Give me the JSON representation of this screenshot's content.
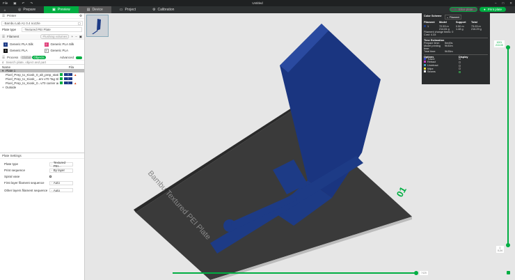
{
  "window": {
    "title": "Untitled",
    "menu": "File"
  },
  "tabs": [
    {
      "label": "Prepare"
    },
    {
      "label": "Preview",
      "active": true
    },
    {
      "label": "Device"
    },
    {
      "label": "Project"
    },
    {
      "label": "Calibration"
    }
  ],
  "actions": {
    "slice": "Slice plate",
    "print": "Print plate"
  },
  "printer": {
    "header": "Printer",
    "name": "Bambu Lab A1 0.4 nozzle",
    "plate_type_label": "Plate type",
    "plate_type": "Textured PEI Plate"
  },
  "filament": {
    "header": "Filament",
    "flushing": "Flushing volumes",
    "items": [
      {
        "num": "1",
        "name": "Generic PLA Silk",
        "color": "#1d3b86"
      },
      {
        "num": "2",
        "name": "Generic PLA Silk",
        "color": "#e0407a"
      },
      {
        "num": "3",
        "name": "Generic PLA",
        "color": "#111111"
      },
      {
        "num": "4",
        "name": "Generic PLA",
        "color": "#ffffff"
      }
    ]
  },
  "process": {
    "header": "Process",
    "global": "Global",
    "objects": "Objects",
    "advanced": "Advanced",
    "search_placeholder": "Search plate, object and part",
    "col_name": "Name",
    "col_fila": "Fila",
    "plate": "Plate 1",
    "objects_list": [
      {
        "name": "Pixel_Prep_to_Kiosk_0_alt_prep_station.stl",
        "fila": "1"
      },
      {
        "name": "Pixel_Prep_to_Kiosk_...em v70 Tag Skins.stl",
        "fila": "1"
      },
      {
        "name": "Pixel_Prep_to_Kiosk_0...v70 carrier arm.stl",
        "fila": "1"
      }
    ],
    "outside": "Outside"
  },
  "plate_settings": {
    "header": "Plate Settings",
    "rows": [
      {
        "label": "Plate type",
        "value": "Textured PEI..."
      },
      {
        "label": "Print sequence",
        "value": "By layer"
      },
      {
        "label": "Spiral vase",
        "value": ""
      },
      {
        "label": "First layer filament sequence",
        "value": "Auto"
      },
      {
        "label": "Other layers filament sequence",
        "value": "Auto"
      }
    ]
  },
  "stats": {
    "color_scheme": "Color Scheme",
    "scheme_value": "Filament",
    "cols": [
      "Filament",
      "Model",
      "Support",
      "Total"
    ],
    "row": {
      "filament": "1",
      "model": "72.53 m\n214.81 g",
      "support": "0.50 m\n1.48 g",
      "total": "73.03 m\n216.29 g"
    },
    "change_times": "Filament change times: 0",
    "cost": "Cost: 4.33",
    "time_header": "Time Estimation",
    "times": [
      {
        "k": "Prepare time:",
        "v": "5m49s"
      },
      {
        "k": "Model printing time:",
        "v": "9h30m"
      },
      {
        "k": "Total time:",
        "v": "9h35m"
      }
    ],
    "options_header": "Options",
    "display_header": "Display",
    "options": [
      {
        "name": "Travel",
        "color": "#3848c8",
        "on": false
      },
      {
        "name": "Retract",
        "color": "#c040c0",
        "on": false
      },
      {
        "name": "Unretract",
        "color": "#40a0c0",
        "on": false
      },
      {
        "name": "Wipe",
        "color": "#e8e040",
        "on": false
      },
      {
        "name": "Seams",
        "color": "#e8e8e8",
        "on": true
      }
    ]
  },
  "layer_slider": {
    "top_layer": "1001",
    "top_height": "213.05",
    "bottom_layer": "1",
    "bottom_height": "0.24"
  },
  "move_slider": {
    "value": "7425"
  },
  "plate_number": "01",
  "plate_label": "Bambu Textured PEI Plate",
  "colors": {
    "accent": "#00ae42",
    "model": "#1d3b86"
  }
}
